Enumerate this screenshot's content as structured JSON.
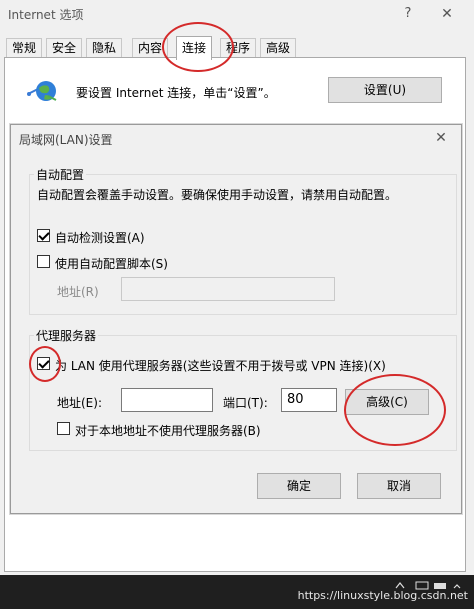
{
  "outer": {
    "title": "Internet 选项",
    "help": "?",
    "close": "✕",
    "tabs": [
      "常规",
      "安全",
      "隐私",
      "内容",
      "连接",
      "程序",
      "高级"
    ],
    "setup_text": "要设置 Internet 连接，单击“设置”。",
    "setup_button": "设置(U)"
  },
  "lan": {
    "title": "局域网(LAN)设置",
    "close": "✕",
    "auto_group": {
      "label": "自动配置",
      "desc": "自动配置会覆盖手动设置。要确保使用手动设置，请禁用自动配置。",
      "detect_label": "自动检测设置(A)",
      "detect_checked": true,
      "script_label": "使用自动配置脚本(S)",
      "script_checked": false,
      "address_label": "地址(R)",
      "address_value": ""
    },
    "proxy_group": {
      "label": "代理服务器",
      "use_proxy_label": "为 LAN 使用代理服务器(这些设置不用于拨号或 VPN 连接)(X)",
      "use_proxy_checked": true,
      "address_label": "地址(E):",
      "address_value": "",
      "port_label": "端口(T):",
      "port_value": "80",
      "advanced_button": "高级(C)",
      "bypass_label": "对于本地地址不使用代理服务器(B)",
      "bypass_checked": false
    },
    "ok_button": "确定",
    "cancel_button": "取消"
  },
  "watermark": "https://linuxstyle.blog.csdn.net",
  "colors": {
    "annotation": "#d42a2a",
    "button_face": "#e1e1e1",
    "dialog_bg": "#f0f0f0"
  }
}
